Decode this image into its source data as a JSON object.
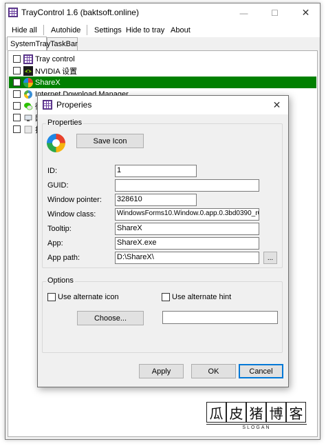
{
  "window": {
    "title": "TrayControl 1.6 (baktsoft.online)",
    "controls": {
      "minimize": "—",
      "maximize": "☐",
      "close": "✕"
    }
  },
  "menu": {
    "hide_all": "Hide all",
    "autohide": "Autohide",
    "settings": "Settings",
    "hide_to_tray": "Hide to tray",
    "about": "About"
  },
  "tabs": [
    {
      "label": "SystemTray",
      "active": true
    },
    {
      "label": "TaskBar",
      "active": false
    }
  ],
  "list": [
    {
      "label": "Tray control",
      "icon": "tray-control-icon",
      "selected": false
    },
    {
      "label": "NVIDIA 设置",
      "icon": "nvidia-icon",
      "selected": false
    },
    {
      "label": "ShareX",
      "icon": "sharex-icon",
      "selected": true
    },
    {
      "label": "Internet Download Manager",
      "icon": "idm-icon",
      "selected": false
    },
    {
      "label": "微",
      "icon": "wechat-icon",
      "selected": false
    },
    {
      "label": "网",
      "icon": "network-icon",
      "selected": false
    },
    {
      "label": "拔",
      "icon": "unknown-icon",
      "selected": false
    }
  ],
  "dialog": {
    "title": "Properies",
    "close": "✕",
    "properties_group": "Properties",
    "save_icon": "Save Icon",
    "fields": {
      "id": {
        "label": "ID:",
        "value": "1"
      },
      "guid": {
        "label": "GUID:",
        "value": ""
      },
      "window_pointer": {
        "label": "Window pointer:",
        "value": "328610"
      },
      "window_class": {
        "label": "Window class:",
        "value": "WindowsForms10.Window.0.app.0.3bd0390_r6_a"
      },
      "tooltip": {
        "label": "Tooltip:",
        "value": "ShareX"
      },
      "app": {
        "label": "App:",
        "value": "ShareX.exe"
      },
      "app_path": {
        "label": "App path:",
        "value": "D:\\ShareX\\"
      }
    },
    "browse": "...",
    "options_group": "Options",
    "use_alternate_icon": "Use alternate icon",
    "use_alternate_hint": "Use alternate hint",
    "choose": "Choose...",
    "hint_value": "",
    "apply": "Apply",
    "ok": "OK",
    "cancel": "Cancel"
  },
  "watermark": {
    "chars": [
      "瓜",
      "皮",
      "猪",
      "博",
      "客"
    ],
    "slogan": "SLOGAN"
  },
  "colors": {
    "selected_row": "#008000",
    "app_icon": "#6b3fa0",
    "default_button_border": "#0078d7"
  }
}
